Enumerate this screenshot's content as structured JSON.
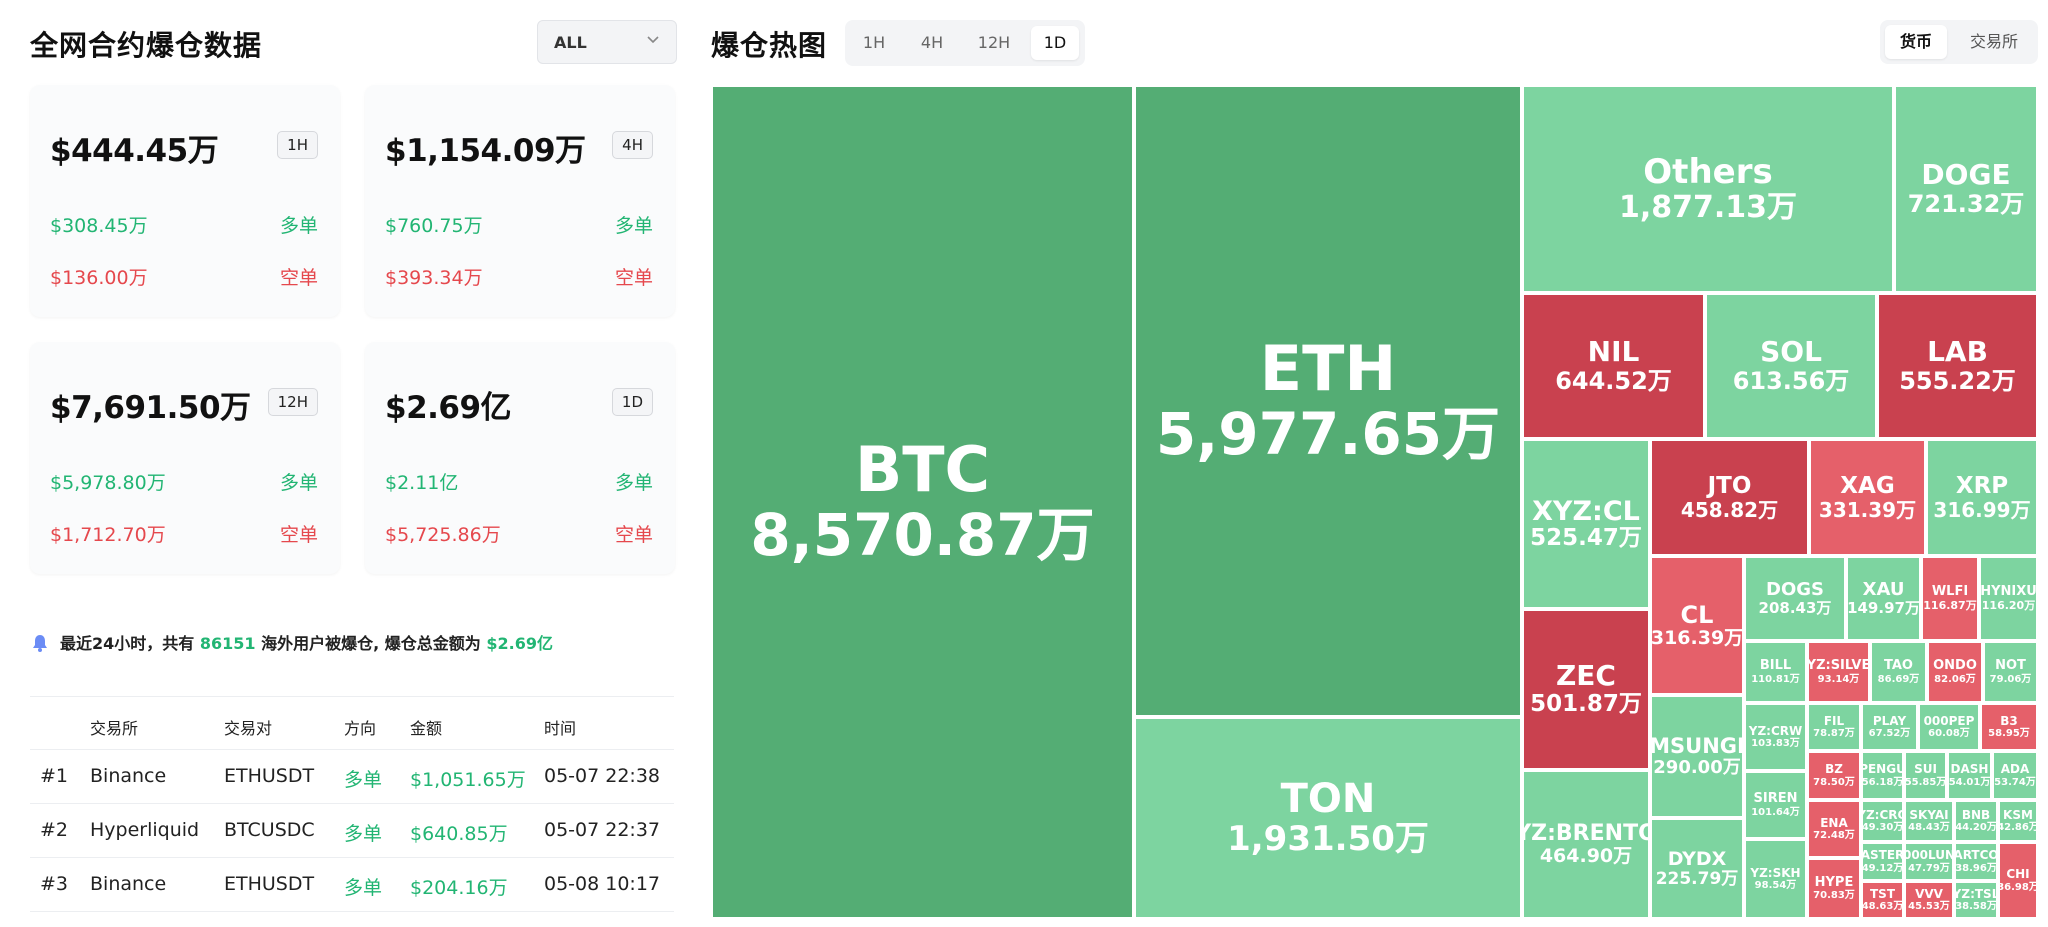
{
  "left": {
    "title": "全网合约爆仓数据",
    "filter": "ALL",
    "cards": [
      {
        "amount": "$444.45万",
        "tf": "1H",
        "long_value": "$308.45万",
        "long_label": "多单",
        "short_value": "$136.00万",
        "short_label": "空单"
      },
      {
        "amount": "$1,154.09万",
        "tf": "4H",
        "long_value": "$760.75万",
        "long_label": "多单",
        "short_value": "$393.34万",
        "short_label": "空单"
      },
      {
        "amount": "$7,691.50万",
        "tf": "12H",
        "long_value": "$5,978.80万",
        "long_label": "多单",
        "short_value": "$1,712.70万",
        "short_label": "空单"
      },
      {
        "amount": "$2.69亿",
        "tf": "1D",
        "long_value": "$2.11亿",
        "long_label": "多单",
        "short_value": "$5,725.86万",
        "short_label": "空单"
      }
    ],
    "notice": {
      "prefix": "最近24小时，共有",
      "count": "86151",
      "middle": "海外用户被爆仓, 爆仓总金额为",
      "total": "$2.69亿"
    },
    "table": {
      "headers": [
        "",
        "交易所",
        "交易对",
        "方向",
        "金额",
        "时间"
      ],
      "rows": [
        [
          "#1",
          "Binance",
          "ETHUSDT",
          "多单",
          "$1,051.65万",
          "05-07 22:38"
        ],
        [
          "#2",
          "Hyperliquid",
          "BTCUSDC",
          "多单",
          "$640.85万",
          "05-07 22:37"
        ],
        [
          "#3",
          "Binance",
          "ETHUSDT",
          "多单",
          "$204.16万",
          "05-08 10:17"
        ]
      ]
    }
  },
  "right": {
    "title": "爆仓热图",
    "timeframes": [
      {
        "label": "1H",
        "active": false
      },
      {
        "label": "4H",
        "active": false
      },
      {
        "label": "12H",
        "active": false
      },
      {
        "label": "1D",
        "active": true
      }
    ],
    "groupings": [
      {
        "label": "货币",
        "active": true
      },
      {
        "label": "交易所",
        "active": false
      }
    ],
    "colors": {
      "long_dark": "#54ad74",
      "long_light": "#7dd4a0",
      "short_dark": "#c9414f",
      "short_light": "#e5606a"
    },
    "tiles": [
      {
        "name": "BTC",
        "value": "8,570.87万",
        "side": "long_dark"
      },
      {
        "name": "ETH",
        "value": "5,977.65万",
        "side": "long_dark"
      },
      {
        "name": "TON",
        "value": "1,931.50万",
        "side": "long_light"
      },
      {
        "name": "Others",
        "value": "1,877.13万",
        "side": "long_light"
      },
      {
        "name": "DOGE",
        "value": "721.32万",
        "side": "long_light"
      },
      {
        "name": "NIL",
        "value": "644.52万",
        "side": "short_dark"
      },
      {
        "name": "SOL",
        "value": "613.56万",
        "side": "long_light"
      },
      {
        "name": "LAB",
        "value": "555.22万",
        "side": "short_dark"
      },
      {
        "name": "XYZ:CL",
        "value": "525.47万",
        "side": "long_light"
      },
      {
        "name": "JTO",
        "value": "458.82万",
        "side": "short_dark"
      },
      {
        "name": "XAG",
        "value": "331.39万",
        "side": "short_light"
      },
      {
        "name": "XRP",
        "value": "316.99万",
        "side": "long_light"
      },
      {
        "name": "ZEC",
        "value": "501.87万",
        "side": "short_dark"
      },
      {
        "name": "CL",
        "value": "316.39万",
        "side": "short_light"
      },
      {
        "name": "DOGS",
        "value": "208.43万",
        "side": "long_light"
      },
      {
        "name": "XAU",
        "value": "149.97万",
        "side": "long_light"
      },
      {
        "name": "WLFI",
        "value": "116.87万",
        "side": "short_light"
      },
      {
        "name": "HYNIXU",
        "value": "116.20万",
        "side": "long_light"
      },
      {
        "name": "BILL",
        "value": "110.81万",
        "side": "long_light"
      },
      {
        "name": "YZ:SILVE",
        "value": "93.14万",
        "side": "short_light"
      },
      {
        "name": "TAO",
        "value": "86.69万",
        "side": "long_light"
      },
      {
        "name": "ONDO",
        "value": "82.06万",
        "side": "short_light"
      },
      {
        "name": "NOT",
        "value": "79.06万",
        "side": "long_light"
      },
      {
        "name": "MSUNGI",
        "value": "290.00万",
        "side": "long_light"
      },
      {
        "name": "YZ:CRW",
        "value": "103.83万",
        "side": "long_light"
      },
      {
        "name": "FIL",
        "value": "78.87万",
        "side": "long_light"
      },
      {
        "name": "PLAY",
        "value": "67.52万",
        "side": "long_light"
      },
      {
        "name": "000PEP",
        "value": "60.08万",
        "side": "long_light"
      },
      {
        "name": "B3",
        "value": "58.95万",
        "side": "short_light"
      },
      {
        "name": "YZ:BRENTO",
        "value": "464.90万",
        "side": "long_light"
      },
      {
        "name": "BZ",
        "value": "78.50万",
        "side": "short_light"
      },
      {
        "name": "PENGU",
        "value": "56.18万",
        "side": "long_light"
      },
      {
        "name": "SUI",
        "value": "55.85万",
        "side": "long_light"
      },
      {
        "name": "DASH",
        "value": "54.01万",
        "side": "long_light"
      },
      {
        "name": "ADA",
        "value": "53.74万",
        "side": "long_light"
      },
      {
        "name": "SIREN",
        "value": "101.64万",
        "side": "long_light"
      },
      {
        "name": "YZ:CRO",
        "value": "49.30万",
        "side": "long_light"
      },
      {
        "name": "SKYAI",
        "value": "48.43万",
        "side": "long_light"
      },
      {
        "name": "BNB",
        "value": "44.20万",
        "side": "long_light"
      },
      {
        "name": "KSM",
        "value": "42.86万",
        "side": "long_light"
      },
      {
        "name": "ENA",
        "value": "72.48万",
        "side": "short_light"
      },
      {
        "name": "DYDX",
        "value": "225.79万",
        "side": "long_light"
      },
      {
        "name": "ASTER",
        "value": "49.12万",
        "side": "long_light"
      },
      {
        "name": "000LUN",
        "value": "47.79万",
        "side": "long_light"
      },
      {
        "name": "ARTCO",
        "value": "38.96万",
        "side": "long_light"
      },
      {
        "name": "CHI",
        "value": "36.98万",
        "side": "short_light"
      },
      {
        "name": "YZ:SKH",
        "value": "98.54万",
        "side": "long_light"
      },
      {
        "name": "HYPE",
        "value": "70.83万",
        "side": "short_light"
      },
      {
        "name": "TST",
        "value": "48.63万",
        "side": "short_light"
      },
      {
        "name": "VVV",
        "value": "45.53万",
        "side": "short_light"
      },
      {
        "name": "YZ:TSL",
        "value": "38.58万",
        "side": "long_light"
      }
    ]
  }
}
